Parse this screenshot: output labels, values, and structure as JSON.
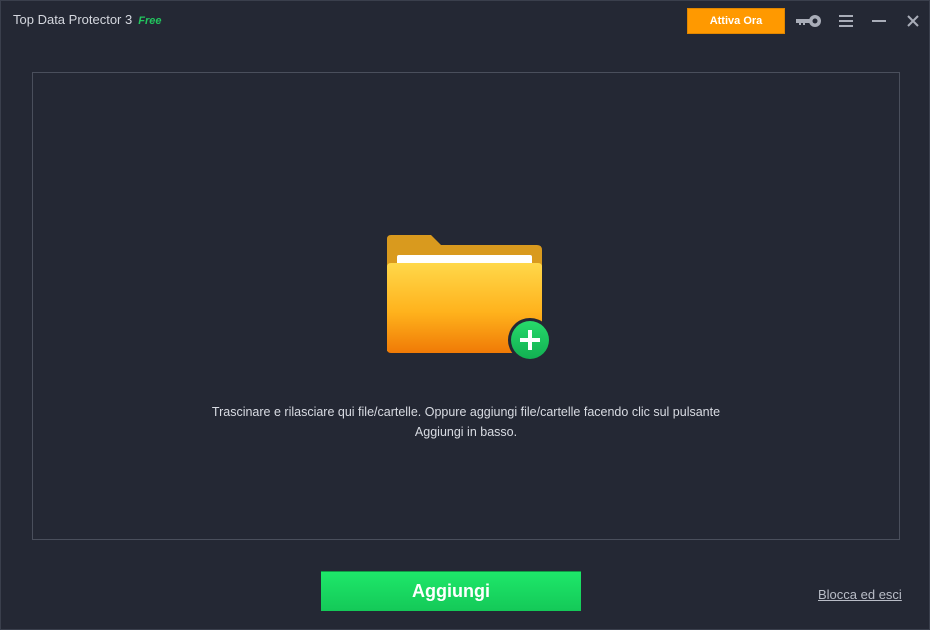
{
  "titlebar": {
    "app_name": "Top Data Protector 3",
    "edition": "Free",
    "activate_label": "Attiva Ora",
    "icons": {
      "license": "key-icon",
      "menu": "hamburger-menu-icon",
      "minimize": "minimize-icon",
      "close": "close-icon"
    }
  },
  "drop_zone": {
    "icon": "folder-add-icon",
    "instruction_line1": "Trascinare e rilasciare qui file/cartelle. Oppure aggiungi file/cartelle facendo clic sul pulsante",
    "instruction_line2": "Aggiungi in basso."
  },
  "footer": {
    "add_label": "Aggiungi",
    "lock_exit_label": "Blocca ed esci"
  },
  "colors": {
    "background": "#242834",
    "accent_orange": "#ff9900",
    "accent_green": "#1ee86a",
    "edition_green": "#22c55e"
  }
}
